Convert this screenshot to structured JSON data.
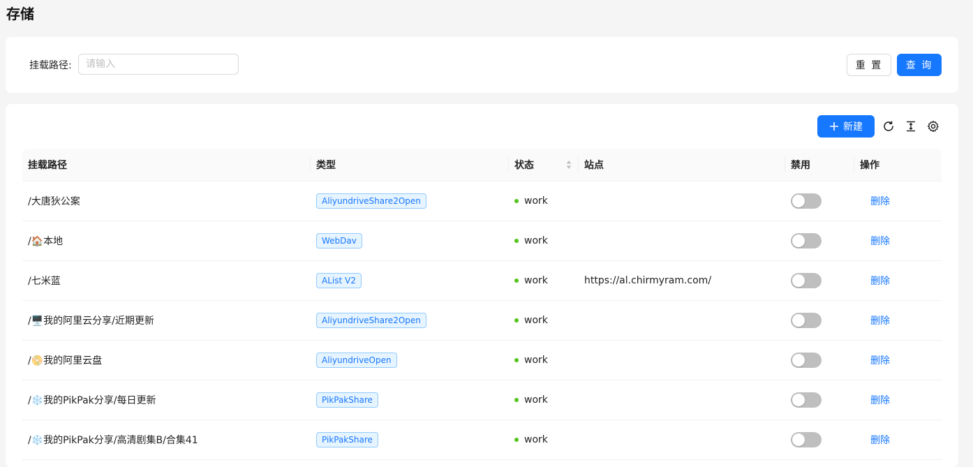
{
  "page": {
    "title": "存储"
  },
  "search": {
    "label": "挂载路径:",
    "placeholder": "请输入",
    "value": "",
    "reset_label": "重 置",
    "query_label": "查 询"
  },
  "toolbar": {
    "new_label": "新建",
    "icons": [
      "plus-icon",
      "reload-icon",
      "column-height-icon",
      "settings-icon"
    ]
  },
  "table": {
    "columns": {
      "path": "挂载路径",
      "type": "类型",
      "status": "状态",
      "site": "站点",
      "disabled": "禁用",
      "action": "操作"
    },
    "rows": [
      {
        "path": "/大唐狄公案",
        "type": "AliyundriveShare2Open",
        "status": "work",
        "site": "",
        "disabled": false,
        "action": "删除"
      },
      {
        "path": "/🏠本地",
        "type": "WebDav",
        "status": "work",
        "site": "",
        "disabled": false,
        "action": "删除"
      },
      {
        "path": "/七米蓝",
        "type": "AList V2",
        "status": "work",
        "site": "https://al.chirmyram.com/",
        "disabled": false,
        "action": "删除"
      },
      {
        "path": "/🖥️我的阿里云分享/近期更新",
        "type": "AliyundriveShare2Open",
        "status": "work",
        "site": "",
        "disabled": false,
        "action": "删除"
      },
      {
        "path": "/📀我的阿里云盘",
        "type": "AliyundriveOpen",
        "status": "work",
        "site": "",
        "disabled": false,
        "action": "删除"
      },
      {
        "path": "/❄️我的PikPak分享/每日更新",
        "type": "PikPakShare",
        "status": "work",
        "site": "",
        "disabled": false,
        "action": "删除"
      },
      {
        "path": "/❄️我的PikPak分享/高清剧集B/合集41",
        "type": "PikPakShare",
        "status": "work",
        "site": "",
        "disabled": false,
        "action": "删除"
      }
    ]
  },
  "colors": {
    "primary": "#1677ff",
    "status_ok": "#52c41a",
    "switch_off": "#bfbfbf"
  }
}
